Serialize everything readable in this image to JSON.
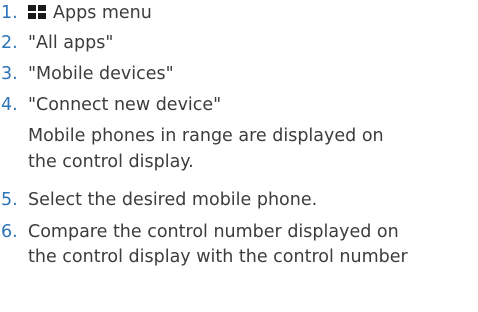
{
  "steps": [
    {
      "number": "1.",
      "icon": "apps-grid-icon",
      "text": "Apps menu"
    },
    {
      "number": "2.",
      "text": "\"All apps\""
    },
    {
      "number": "3.",
      "text": "\"Mobile devices\""
    },
    {
      "number": "4.",
      "text": "\"Connect new device\""
    },
    {
      "number": "5.",
      "text": "Select the desired mobile phone."
    },
    {
      "number": "6.",
      "text_line1": "Compare the control number displayed on",
      "text_line2": "the control display with the control number"
    }
  ],
  "note_after_step_4": {
    "line1": "Mobile phones in range are displayed on",
    "line2": "the control display."
  },
  "colors": {
    "number": "#2e74b8",
    "text": "#3c3c3c",
    "icon": "#1a1a1a"
  }
}
